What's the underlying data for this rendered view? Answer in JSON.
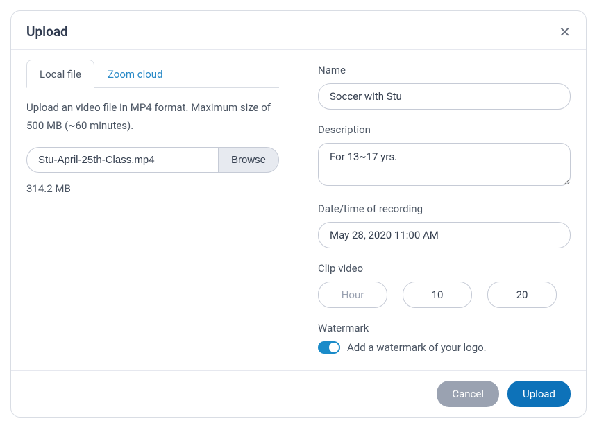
{
  "modal": {
    "title": "Upload"
  },
  "tabs": {
    "local": "Local file",
    "zoom": "Zoom cloud"
  },
  "left": {
    "help": "Upload an video file in MP4 format. Maximum size of 500 MB (~60 minutes).",
    "filename": "Stu-April-25th-Class.mp4",
    "browse": "Browse",
    "filesize": "314.2 MB"
  },
  "fields": {
    "name": {
      "label": "Name",
      "value": "Soccer with Stu"
    },
    "description": {
      "label": "Description",
      "value": "For 13~17 yrs."
    },
    "datetime": {
      "label": "Date/time of recording",
      "value": "May 28, 2020 11:00 AM"
    },
    "clip": {
      "label": "Clip video",
      "hour_placeholder": "Hour",
      "hour_value": "",
      "minute_value": "10",
      "second_value": "20"
    },
    "watermark": {
      "label": "Watermark",
      "toggle_label": "Add a watermark of your logo.",
      "on": true
    }
  },
  "footer": {
    "cancel": "Cancel",
    "upload": "Upload"
  }
}
